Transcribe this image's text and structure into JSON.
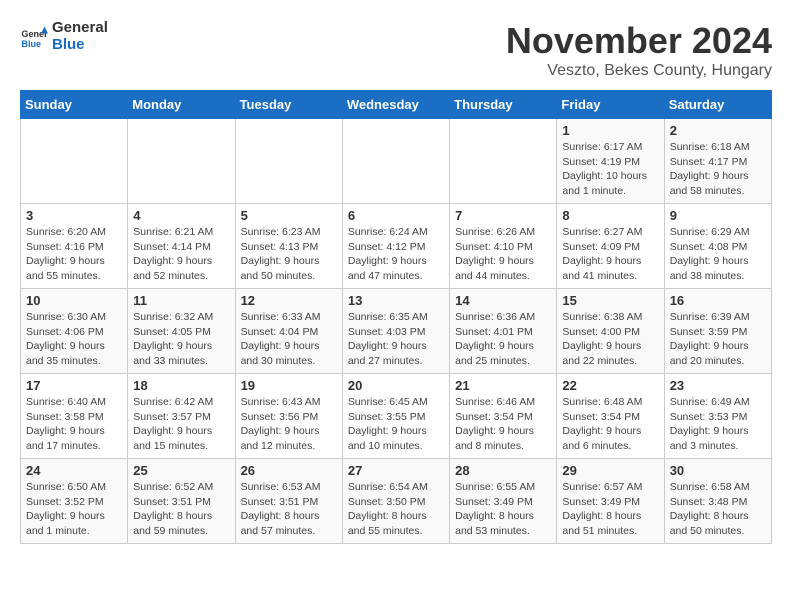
{
  "header": {
    "logo_general": "General",
    "logo_blue": "Blue",
    "title": "November 2024",
    "subtitle": "Veszto, Bekes County, Hungary"
  },
  "columns": [
    "Sunday",
    "Monday",
    "Tuesday",
    "Wednesday",
    "Thursday",
    "Friday",
    "Saturday"
  ],
  "weeks": [
    [
      {
        "day": "",
        "info": ""
      },
      {
        "day": "",
        "info": ""
      },
      {
        "day": "",
        "info": ""
      },
      {
        "day": "",
        "info": ""
      },
      {
        "day": "",
        "info": ""
      },
      {
        "day": "1",
        "info": "Sunrise: 6:17 AM\nSunset: 4:19 PM\nDaylight: 10 hours and 1 minute."
      },
      {
        "day": "2",
        "info": "Sunrise: 6:18 AM\nSunset: 4:17 PM\nDaylight: 9 hours and 58 minutes."
      }
    ],
    [
      {
        "day": "3",
        "info": "Sunrise: 6:20 AM\nSunset: 4:16 PM\nDaylight: 9 hours and 55 minutes."
      },
      {
        "day": "4",
        "info": "Sunrise: 6:21 AM\nSunset: 4:14 PM\nDaylight: 9 hours and 52 minutes."
      },
      {
        "day": "5",
        "info": "Sunrise: 6:23 AM\nSunset: 4:13 PM\nDaylight: 9 hours and 50 minutes."
      },
      {
        "day": "6",
        "info": "Sunrise: 6:24 AM\nSunset: 4:12 PM\nDaylight: 9 hours and 47 minutes."
      },
      {
        "day": "7",
        "info": "Sunrise: 6:26 AM\nSunset: 4:10 PM\nDaylight: 9 hours and 44 minutes."
      },
      {
        "day": "8",
        "info": "Sunrise: 6:27 AM\nSunset: 4:09 PM\nDaylight: 9 hours and 41 minutes."
      },
      {
        "day": "9",
        "info": "Sunrise: 6:29 AM\nSunset: 4:08 PM\nDaylight: 9 hours and 38 minutes."
      }
    ],
    [
      {
        "day": "10",
        "info": "Sunrise: 6:30 AM\nSunset: 4:06 PM\nDaylight: 9 hours and 35 minutes."
      },
      {
        "day": "11",
        "info": "Sunrise: 6:32 AM\nSunset: 4:05 PM\nDaylight: 9 hours and 33 minutes."
      },
      {
        "day": "12",
        "info": "Sunrise: 6:33 AM\nSunset: 4:04 PM\nDaylight: 9 hours and 30 minutes."
      },
      {
        "day": "13",
        "info": "Sunrise: 6:35 AM\nSunset: 4:03 PM\nDaylight: 9 hours and 27 minutes."
      },
      {
        "day": "14",
        "info": "Sunrise: 6:36 AM\nSunset: 4:01 PM\nDaylight: 9 hours and 25 minutes."
      },
      {
        "day": "15",
        "info": "Sunrise: 6:38 AM\nSunset: 4:00 PM\nDaylight: 9 hours and 22 minutes."
      },
      {
        "day": "16",
        "info": "Sunrise: 6:39 AM\nSunset: 3:59 PM\nDaylight: 9 hours and 20 minutes."
      }
    ],
    [
      {
        "day": "17",
        "info": "Sunrise: 6:40 AM\nSunset: 3:58 PM\nDaylight: 9 hours and 17 minutes."
      },
      {
        "day": "18",
        "info": "Sunrise: 6:42 AM\nSunset: 3:57 PM\nDaylight: 9 hours and 15 minutes."
      },
      {
        "day": "19",
        "info": "Sunrise: 6:43 AM\nSunset: 3:56 PM\nDaylight: 9 hours and 12 minutes."
      },
      {
        "day": "20",
        "info": "Sunrise: 6:45 AM\nSunset: 3:55 PM\nDaylight: 9 hours and 10 minutes."
      },
      {
        "day": "21",
        "info": "Sunrise: 6:46 AM\nSunset: 3:54 PM\nDaylight: 9 hours and 8 minutes."
      },
      {
        "day": "22",
        "info": "Sunrise: 6:48 AM\nSunset: 3:54 PM\nDaylight: 9 hours and 6 minutes."
      },
      {
        "day": "23",
        "info": "Sunrise: 6:49 AM\nSunset: 3:53 PM\nDaylight: 9 hours and 3 minutes."
      }
    ],
    [
      {
        "day": "24",
        "info": "Sunrise: 6:50 AM\nSunset: 3:52 PM\nDaylight: 9 hours and 1 minute."
      },
      {
        "day": "25",
        "info": "Sunrise: 6:52 AM\nSunset: 3:51 PM\nDaylight: 8 hours and 59 minutes."
      },
      {
        "day": "26",
        "info": "Sunrise: 6:53 AM\nSunset: 3:51 PM\nDaylight: 8 hours and 57 minutes."
      },
      {
        "day": "27",
        "info": "Sunrise: 6:54 AM\nSunset: 3:50 PM\nDaylight: 8 hours and 55 minutes."
      },
      {
        "day": "28",
        "info": "Sunrise: 6:55 AM\nSunset: 3:49 PM\nDaylight: 8 hours and 53 minutes."
      },
      {
        "day": "29",
        "info": "Sunrise: 6:57 AM\nSunset: 3:49 PM\nDaylight: 8 hours and 51 minutes."
      },
      {
        "day": "30",
        "info": "Sunrise: 6:58 AM\nSunset: 3:48 PM\nDaylight: 8 hours and 50 minutes."
      }
    ]
  ]
}
